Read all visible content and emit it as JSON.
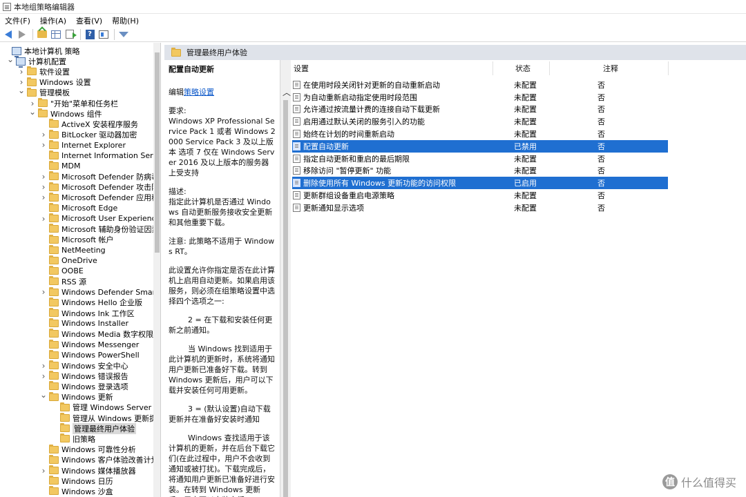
{
  "window": {
    "title": "本地组策略编辑器"
  },
  "menu": [
    "文件(F)",
    "操作(A)",
    "查看(V)",
    "帮助(H)"
  ],
  "toolbar": {
    "buttons": [
      "back-icon",
      "forward-icon",
      "up-folder-icon",
      "show-hide-tree-icon",
      "export-list-icon",
      "help-icon",
      "properties-icon",
      "filter-icon"
    ],
    "help_glyph": "?"
  },
  "tree": {
    "items": [
      {
        "label": "本地计算机 策略",
        "level": 0,
        "toggle": "none",
        "icon": "pc"
      },
      {
        "label": "计算机配置",
        "level": 1,
        "toggle": "exp",
        "icon": "pc"
      },
      {
        "label": "软件设置",
        "level": 2,
        "toggle": "col",
        "icon": "folder"
      },
      {
        "label": "Windows 设置",
        "level": 2,
        "toggle": "col",
        "icon": "folder"
      },
      {
        "label": "管理模板",
        "level": 2,
        "toggle": "exp",
        "icon": "folder"
      },
      {
        "label": "\"开始\"菜单和任务栏",
        "level": 3,
        "toggle": "col",
        "icon": "folder"
      },
      {
        "label": "Windows 组件",
        "level": 3,
        "toggle": "exp",
        "icon": "folder"
      },
      {
        "label": "ActiveX 安装程序服务",
        "level": 4,
        "toggle": "none",
        "icon": "folder"
      },
      {
        "label": "BitLocker 驱动器加密",
        "level": 4,
        "toggle": "col",
        "icon": "folder"
      },
      {
        "label": "Internet Explorer",
        "level": 4,
        "toggle": "col",
        "icon": "folder"
      },
      {
        "label": "Internet Information Services",
        "level": 4,
        "toggle": "none",
        "icon": "folder"
      },
      {
        "label": "MDM",
        "level": 4,
        "toggle": "none",
        "icon": "folder"
      },
      {
        "label": "Microsoft Defender 防病毒",
        "level": 4,
        "toggle": "col",
        "icon": "folder"
      },
      {
        "label": "Microsoft Defender 攻击防护",
        "level": 4,
        "toggle": "col",
        "icon": "folder"
      },
      {
        "label": "Microsoft Defender 应用程序",
        "level": 4,
        "toggle": "col",
        "icon": "folder"
      },
      {
        "label": "Microsoft Edge",
        "level": 4,
        "toggle": "none",
        "icon": "folder"
      },
      {
        "label": "Microsoft User Experience Vi",
        "level": 4,
        "toggle": "col",
        "icon": "folder"
      },
      {
        "label": "Microsoft 辅助身份验证因素",
        "level": 4,
        "toggle": "none",
        "icon": "folder"
      },
      {
        "label": "Microsoft 帐户",
        "level": 4,
        "toggle": "none",
        "icon": "folder"
      },
      {
        "label": "NetMeeting",
        "level": 4,
        "toggle": "none",
        "icon": "folder"
      },
      {
        "label": "OneDrive",
        "level": 4,
        "toggle": "none",
        "icon": "folder"
      },
      {
        "label": "OOBE",
        "level": 4,
        "toggle": "none",
        "icon": "folder"
      },
      {
        "label": "RSS 源",
        "level": 4,
        "toggle": "none",
        "icon": "folder"
      },
      {
        "label": "Windows Defender SmartScr",
        "level": 4,
        "toggle": "col",
        "icon": "folder"
      },
      {
        "label": "Windows Hello 企业版",
        "level": 4,
        "toggle": "none",
        "icon": "folder"
      },
      {
        "label": "Windows Ink 工作区",
        "level": 4,
        "toggle": "none",
        "icon": "folder"
      },
      {
        "label": "Windows Installer",
        "level": 4,
        "toggle": "none",
        "icon": "folder"
      },
      {
        "label": "Windows Media 数字权限管理",
        "level": 4,
        "toggle": "none",
        "icon": "folder"
      },
      {
        "label": "Windows Messenger",
        "level": 4,
        "toggle": "none",
        "icon": "folder"
      },
      {
        "label": "Windows PowerShell",
        "level": 4,
        "toggle": "none",
        "icon": "folder"
      },
      {
        "label": "Windows 安全中心",
        "level": 4,
        "toggle": "col",
        "icon": "folder"
      },
      {
        "label": "Windows 错误报告",
        "level": 4,
        "toggle": "col",
        "icon": "folder"
      },
      {
        "label": "Windows 登录选项",
        "level": 4,
        "toggle": "none",
        "icon": "folder"
      },
      {
        "label": "Windows 更新",
        "level": 4,
        "toggle": "exp",
        "icon": "folder"
      },
      {
        "label": "管理 Windows Server Upc",
        "level": 5,
        "toggle": "none",
        "icon": "folder"
      },
      {
        "label": "管理从 Windows 更新提供",
        "level": 5,
        "toggle": "none",
        "icon": "folder"
      },
      {
        "label": "管理最终用户体验",
        "level": 5,
        "toggle": "none",
        "icon": "folder",
        "selected": true
      },
      {
        "label": "旧策略",
        "level": 5,
        "toggle": "none",
        "icon": "folder"
      },
      {
        "label": "Windows 可靠性分析",
        "level": 4,
        "toggle": "none",
        "icon": "folder"
      },
      {
        "label": "Windows 客户体验改善计划",
        "level": 4,
        "toggle": "none",
        "icon": "folder"
      },
      {
        "label": "Windows 媒体播放器",
        "level": 4,
        "toggle": "col",
        "icon": "folder"
      },
      {
        "label": "Windows 日历",
        "level": 4,
        "toggle": "none",
        "icon": "folder"
      },
      {
        "label": "Windows 沙盒",
        "level": 4,
        "toggle": "none",
        "icon": "folder"
      }
    ]
  },
  "folder_header": {
    "label": "管理最终用户体验"
  },
  "description": {
    "title": "配置自动更新",
    "edit_prefix": "编辑",
    "edit_link": "策略设置",
    "paragraphs": [
      "要求:\nWindows XP Professional Service Pack 1 或者 Windows 2000 Service Pack 3 及以上版本 选项 7 仅在 Windows Server 2016 及以上版本的服务器上受支持",
      "描述:\n指定此计算机是否通过 Windows 自动更新服务接收安全更新和其他重要下载。",
      "注意: 此策略不适用于 Windows RT。",
      "此设置允许你指定是否在此计算机上启用自动更新。如果启用该服务，则必须在组策略设置中选择四个选项之一:",
      "        2 = 在下载和安装任何更新之前通知。",
      "        当 Windows 找到适用于此计算机的更新时，系统将通知用户更新已准备好下载。转到 Windows 更新后，用户可以下载并安装任何可用更新。",
      "        3 = (默认设置)自动下载更新并在准备好安装时通知",
      "        Windows 查找适用于该计算机的更新，并在后台下载它们(在此过程中，用户不会收到通知或被打扰)。下载完成后，将通知用户更新已准备好进行安装。在转到 Windows 更新后，用户可以安装它们。"
    ]
  },
  "list": {
    "headers": {
      "setting": "设置",
      "state": "状态",
      "note": "注释"
    },
    "rows": [
      {
        "name": "在使用时段关闭针对更新的自动重新启动",
        "state": "未配置",
        "note": "否",
        "selected": false
      },
      {
        "name": "为自动重新启动指定使用时段范围",
        "state": "未配置",
        "note": "否",
        "selected": false
      },
      {
        "name": "允许通过按流量计费的连接自动下载更新",
        "state": "未配置",
        "note": "否",
        "selected": false
      },
      {
        "name": "启用通过默认关闭的服务引入的功能",
        "state": "未配置",
        "note": "否",
        "selected": false
      },
      {
        "name": "始终在计划的时间重新启动",
        "state": "未配置",
        "note": "否",
        "selected": false
      },
      {
        "name": "配置自动更新",
        "state": "已禁用",
        "note": "否",
        "selected": true
      },
      {
        "name": "指定自动更新和重启的最后期限",
        "state": "未配置",
        "note": "否",
        "selected": false
      },
      {
        "name": "移除访问 \"暂停更新\" 功能",
        "state": "未配置",
        "note": "否",
        "selected": false
      },
      {
        "name": "删除使用所有 Windows 更新功能的访问权限",
        "state": "已启用",
        "note": "否",
        "selected": true
      },
      {
        "name": "更新群组设备重启电源策略",
        "state": "未配置",
        "note": "否",
        "selected": false
      },
      {
        "name": "更新通知显示选项",
        "state": "未配置",
        "note": "否",
        "selected": false
      }
    ]
  },
  "watermark": {
    "glyph": "值",
    "text": "什么值得买"
  },
  "colors": {
    "selection": "#1f6fd1",
    "folder": "#f2c861",
    "link": "#0b57c9"
  }
}
